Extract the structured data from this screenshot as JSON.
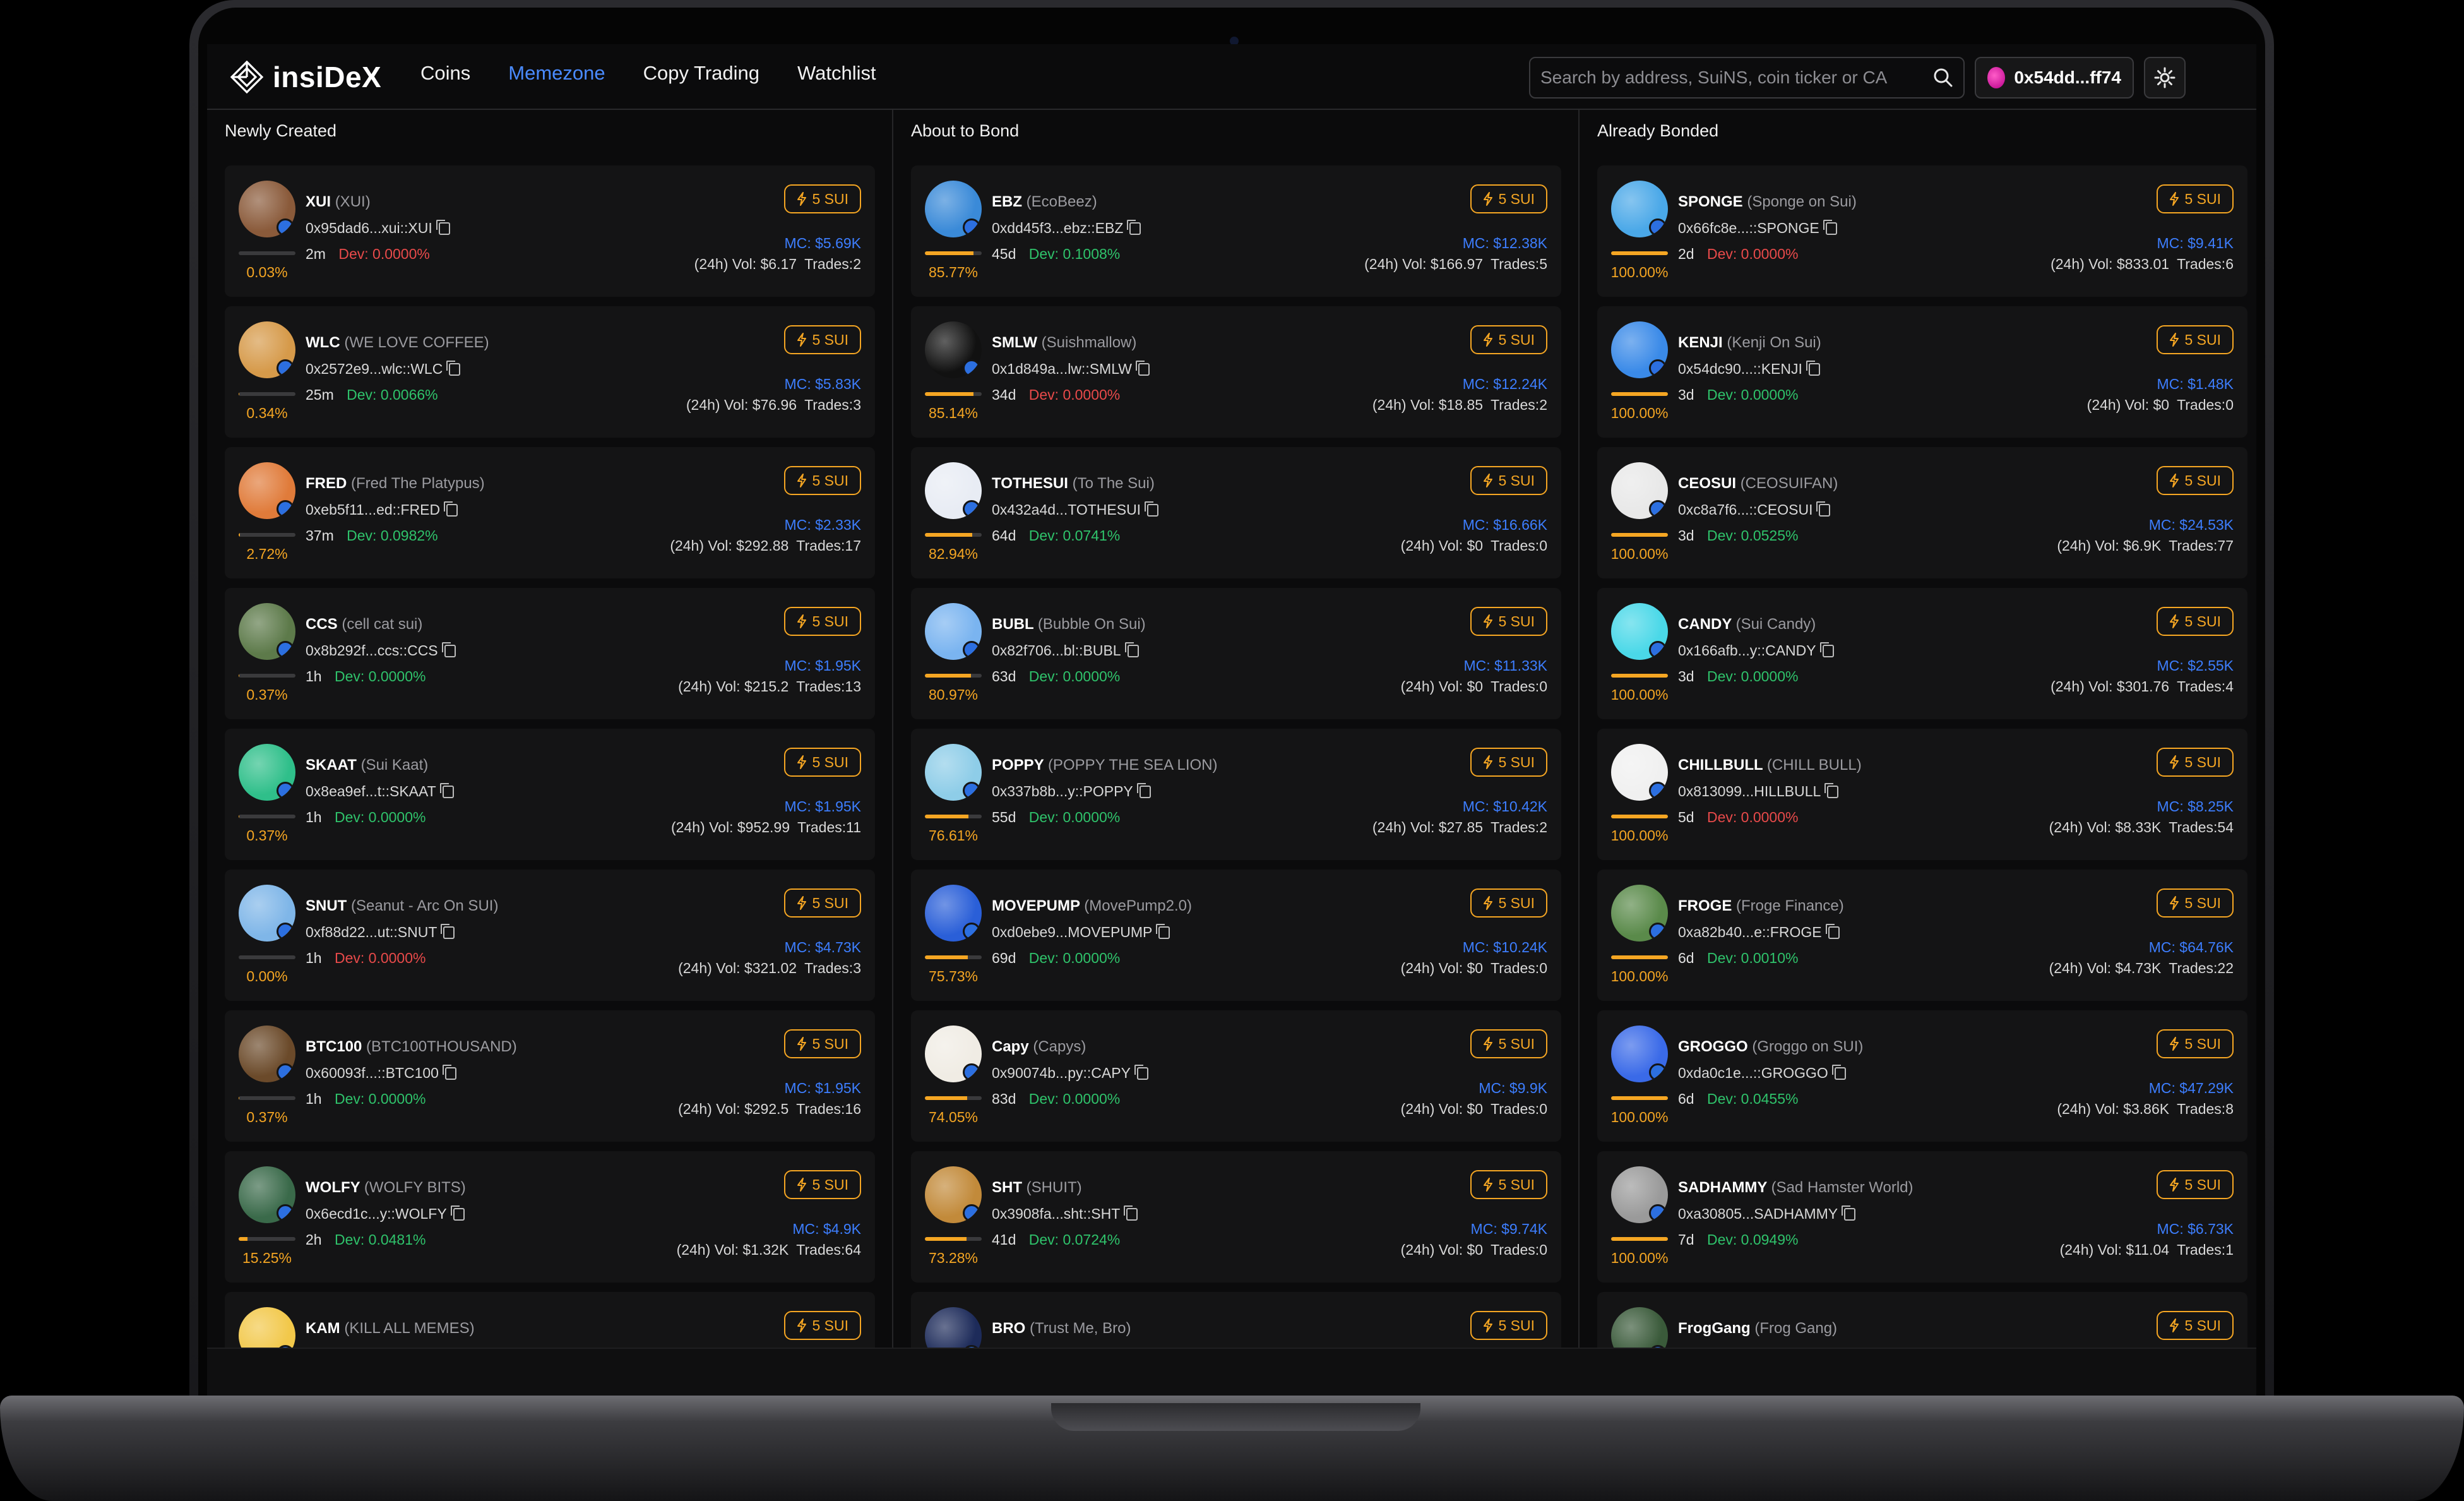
{
  "app": {
    "name": "insiDeX"
  },
  "nav": {
    "items": [
      "Coins",
      "Memezone",
      "Copy Trading",
      "Watchlist"
    ],
    "active": "Memezone"
  },
  "search": {
    "placeholder": "Search by address, SuiNS, coin ticker or CA"
  },
  "wallet": {
    "address": "0x54dd...ff74"
  },
  "colors": {
    "accent": "#4a8bff",
    "buy": "#f5a623",
    "mc": "#3d7eff",
    "dev_negative": "#e84a4a",
    "dev_positive": "#2fc36b"
  },
  "buy_label": "5 SUI",
  "columns": [
    {
      "title": "Newly Created",
      "cards": [
        {
          "ticker": "XUI",
          "name": "(XUI)",
          "address": "0x95dad6...xui::XUI",
          "age": "2m",
          "dev": "Dev: 0.0000%",
          "dev_color": "red",
          "progress": "0.03%",
          "progress_value": 0.03,
          "mc": "MC: $5.69K",
          "vol": "(24h) Vol: $6.17",
          "trades": "Trades:2",
          "avatar": "#8a5a3a",
          "icon": "horse-avatar-icon"
        },
        {
          "ticker": "WLC",
          "name": "(WE LOVE COFFEE)",
          "address": "0x2572e9...wlc::WLC",
          "age": "25m",
          "dev": "Dev: 0.0066%",
          "dev_color": "green",
          "progress": "0.34%",
          "progress_value": 0.34,
          "mc": "MC: $5.83K",
          "vol": "(24h) Vol: $76.96",
          "trades": "Trades:3",
          "avatar": "#d69a4a",
          "icon": "coffee-heart-avatar-icon"
        },
        {
          "ticker": "FRED",
          "name": "(Fred The Platypus)",
          "address": "0xeb5f11...ed::FRED",
          "age": "37m",
          "dev": "Dev: 0.0982%",
          "dev_color": "green",
          "progress": "2.72%",
          "progress_value": 2.72,
          "mc": "MC: $2.33K",
          "vol": "(24h) Vol: $292.88",
          "trades": "Trades:17",
          "avatar": "#e07b3a",
          "icon": "platypus-avatar-icon"
        },
        {
          "ticker": "CCS",
          "name": "(cell cat sui)",
          "address": "0x8b292f...ccs::CCS",
          "age": "1h",
          "dev": "Dev: 0.0000%",
          "dev_color": "green",
          "progress": "0.37%",
          "progress_value": 0.37,
          "mc": "MC: $1.95K",
          "vol": "(24h) Vol: $215.2",
          "trades": "Trades:13",
          "avatar": "#5d7a4a",
          "icon": "cat-avatar-icon"
        },
        {
          "ticker": "SKAAT",
          "name": "(Sui Kaat)",
          "address": "0x8ea9ef...t::SKAAT",
          "age": "1h",
          "dev": "Dev: 0.0000%",
          "dev_color": "green",
          "progress": "0.37%",
          "progress_value": 0.37,
          "mc": "MC: $1.95K",
          "vol": "(24h) Vol: $952.99",
          "trades": "Trades:11",
          "avatar": "#2fbf8a",
          "icon": "tiger-avatar-icon"
        },
        {
          "ticker": "SNUT",
          "name": "(Seanut - Arc On SUI)",
          "address": "0xf88d22...ut::SNUT",
          "age": "1h",
          "dev": "Dev: 0.0000%",
          "dev_color": "red",
          "progress": "0.00%",
          "progress_value": 0,
          "mc": "MC: $4.73K",
          "vol": "(24h) Vol: $321.02",
          "trades": "Trades:3",
          "avatar": "#7fb6e8",
          "icon": "squirrel-avatar-icon"
        },
        {
          "ticker": "BTC100",
          "name": "(BTC100THOUSAND)",
          "address": "0x60093f...::BTC100",
          "age": "1h",
          "dev": "Dev: 0.0000%",
          "dev_color": "green",
          "progress": "0.37%",
          "progress_value": 0.37,
          "mc": "MC: $1.95K",
          "vol": "(24h) Vol: $292.5",
          "trades": "Trades:16",
          "avatar": "#6b4a2a",
          "icon": "monkey-avatar-icon"
        },
        {
          "ticker": "WOLFY",
          "name": "(WOLFY BITS)",
          "address": "0x6ecd1c...y::WOLFY",
          "age": "2h",
          "dev": "Dev: 0.0481%",
          "dev_color": "green",
          "progress": "15.25%",
          "progress_value": 15.25,
          "mc": "MC: $4.9K",
          "vol": "(24h) Vol: $1.32K",
          "trades": "Trades:64",
          "avatar": "#3a6a4a",
          "icon": "wolf-avatar-icon"
        },
        {
          "ticker": "KAM",
          "name": "(KILL ALL MEMES)",
          "address": "",
          "age": "",
          "dev": "",
          "dev_color": "green",
          "progress": "",
          "progress_value": 0,
          "mc": "",
          "vol": "",
          "trades": "",
          "avatar": "#f2c84a",
          "icon": "face-avatar-icon"
        }
      ]
    },
    {
      "title": "About to Bond",
      "cards": [
        {
          "ticker": "EBZ",
          "name": "(EcoBeez)",
          "address": "0xdd45f3...ebz::EBZ",
          "age": "45d",
          "dev": "Dev: 0.1008%",
          "dev_color": "green",
          "progress": "85.77%",
          "progress_value": 85.77,
          "mc": "MC: $12.38K",
          "vol": "(24h) Vol: $166.97",
          "trades": "Trades:5",
          "avatar": "#3a8ad8",
          "icon": "bee-avatar-icon"
        },
        {
          "ticker": "SMLW",
          "name": "(Suishmallow)",
          "address": "0x1d849a...lw::SMLW",
          "age": "34d",
          "dev": "Dev: 0.0000%",
          "dev_color": "red",
          "progress": "85.14%",
          "progress_value": 85.14,
          "mc": "MC: $12.24K",
          "vol": "(24h) Vol: $18.85",
          "trades": "Trades:2",
          "avatar": "#111111",
          "icon": "marshmallow-avatar-icon"
        },
        {
          "ticker": "TOTHESUI",
          "name": "(To The Sui)",
          "address": "0x432a4d...TOTHESUI",
          "age": "64d",
          "dev": "Dev: 0.0741%",
          "dev_color": "green",
          "progress": "82.94%",
          "progress_value": 82.94,
          "mc": "MC: $16.66K",
          "vol": "(24h) Vol: $0",
          "trades": "Trades:0",
          "avatar": "#e8ecf4",
          "icon": "rocket-avatar-icon"
        },
        {
          "ticker": "BUBL",
          "name": "(Bubble On Sui)",
          "address": "0x82f706...bl::BUBL",
          "age": "63d",
          "dev": "Dev: 0.0000%",
          "dev_color": "green",
          "progress": "80.97%",
          "progress_value": 80.97,
          "mc": "MC: $11.33K",
          "vol": "(24h) Vol: $0",
          "trades": "Trades:0",
          "avatar": "#7ab4f0",
          "icon": "pig-avatar-icon"
        },
        {
          "ticker": "POPPY",
          "name": "(POPPY THE SEA LION)",
          "address": "0x337b8b...y::POPPY",
          "age": "55d",
          "dev": "Dev: 0.0000%",
          "dev_color": "green",
          "progress": "76.61%",
          "progress_value": 76.61,
          "mc": "MC: $10.42K",
          "vol": "(24h) Vol: $27.85",
          "trades": "Trades:2",
          "avatar": "#8ecde8",
          "icon": "sea-lion-avatar-icon"
        },
        {
          "ticker": "MOVEPUMP",
          "name": "(MovePump2.0)",
          "address": "0xd0ebe9...MOVEPUMP",
          "age": "69d",
          "dev": "Dev: 0.0000%",
          "dev_color": "green",
          "progress": "75.73%",
          "progress_value": 75.73,
          "mc": "MC: $10.24K",
          "vol": "(24h) Vol: $0",
          "trades": "Trades:0",
          "avatar": "#2a5fd8",
          "icon": "wave-avatar-icon"
        },
        {
          "ticker": "Capy",
          "name": "(Capys)",
          "address": "0x90074b...py::CAPY",
          "age": "83d",
          "dev": "Dev: 0.0000%",
          "dev_color": "green",
          "progress": "74.05%",
          "progress_value": 74.05,
          "mc": "MC: $9.9K",
          "vol": "(24h) Vol: $0",
          "trades": "Trades:0",
          "avatar": "#f0ece4",
          "icon": "capybara-avatar-icon"
        },
        {
          "ticker": "SHT",
          "name": "(SHUIT)",
          "address": "0x3908fa...sht::SHT",
          "age": "41d",
          "dev": "Dev: 0.0724%",
          "dev_color": "green",
          "progress": "73.28%",
          "progress_value": 73.28,
          "mc": "MC: $9.74K",
          "vol": "(24h) Vol: $0",
          "trades": "Trades:0",
          "avatar": "#c28a3a",
          "icon": "blob-avatar-icon"
        },
        {
          "ticker": "BRO",
          "name": "(Trust Me, Bro)",
          "address": "",
          "age": "",
          "dev": "",
          "dev_color": "green",
          "progress": "",
          "progress_value": 0,
          "mc": "",
          "vol": "",
          "trades": "",
          "avatar": "#1d2b5a",
          "icon": "bro-avatar-icon"
        }
      ]
    },
    {
      "title": "Already Bonded",
      "cards": [
        {
          "ticker": "SPONGE",
          "name": "(Sponge on Sui)",
          "address": "0x66fc8e...::SPONGE",
          "age": "2d",
          "dev": "Dev: 0.0000%",
          "dev_color": "red",
          "progress": "100.00%",
          "progress_value": 100,
          "mc": "MC: $9.41K",
          "vol": "(24h) Vol: $833.01",
          "trades": "Trades:6",
          "avatar": "#4aa8e8",
          "icon": "sponge-avatar-icon"
        },
        {
          "ticker": "KENJI",
          "name": "(Kenji On Sui)",
          "address": "0x54dc90...::KENJI",
          "age": "3d",
          "dev": "Dev: 0.0000%",
          "dev_color": "green",
          "progress": "100.00%",
          "progress_value": 100,
          "mc": "MC: $1.48K",
          "vol": "(24h) Vol: $0",
          "trades": "Trades:0",
          "avatar": "#3a8ae8",
          "icon": "dog-avatar-icon"
        },
        {
          "ticker": "CEOSUI",
          "name": "(CEOSUIFAN)",
          "address": "0xc8a7f6...::CEOSUI",
          "age": "3d",
          "dev": "Dev: 0.0525%",
          "dev_color": "green",
          "progress": "100.00%",
          "progress_value": 100,
          "mc": "MC: $24.53K",
          "vol": "(24h) Vol: $6.9K",
          "trades": "Trades:77",
          "avatar": "#e8e8e8",
          "icon": "ceo-avatar-icon"
        },
        {
          "ticker": "CANDY",
          "name": "(Sui Candy)",
          "address": "0x166afb...y::CANDY",
          "age": "3d",
          "dev": "Dev: 0.0000%",
          "dev_color": "green",
          "progress": "100.00%",
          "progress_value": 100,
          "mc": "MC: $2.55K",
          "vol": "(24h) Vol: $301.76",
          "trades": "Trades:4",
          "avatar": "#4ad8e8",
          "icon": "candy-avatar-icon"
        },
        {
          "ticker": "CHILLBULL",
          "name": "(CHILL BULL)",
          "address": "0x813099...HILLBULL",
          "age": "5d",
          "dev": "Dev: 0.0000%",
          "dev_color": "red",
          "progress": "100.00%",
          "progress_value": 100,
          "mc": "MC: $8.25K",
          "vol": "(24h) Vol: $8.33K",
          "trades": "Trades:54",
          "avatar": "#f0f0f0",
          "icon": "bull-avatar-icon"
        },
        {
          "ticker": "FROGE",
          "name": "(Froge Finance)",
          "address": "0xa82b40...e::FROGE",
          "age": "6d",
          "dev": "Dev: 0.0010%",
          "dev_color": "green",
          "progress": "100.00%",
          "progress_value": 100,
          "mc": "MC: $64.76K",
          "vol": "(24h) Vol: $4.73K",
          "trades": "Trades:22",
          "avatar": "#5a8a4a",
          "icon": "frog-avatar-icon"
        },
        {
          "ticker": "GROGGO",
          "name": "(Groggo on SUI)",
          "address": "0xda0c1e...::GROGGO",
          "age": "6d",
          "dev": "Dev: 0.0455%",
          "dev_color": "green",
          "progress": "100.00%",
          "progress_value": 100,
          "mc": "MC: $47.29K",
          "vol": "(24h) Vol: $3.86K",
          "trades": "Trades:8",
          "avatar": "#3a6ae8",
          "icon": "groggo-avatar-icon"
        },
        {
          "ticker": "SADHAMMY",
          "name": "(Sad Hamster World)",
          "address": "0xa30805...SADHAMMY",
          "age": "7d",
          "dev": "Dev: 0.0949%",
          "dev_color": "green",
          "progress": "100.00%",
          "progress_value": 100,
          "mc": "MC: $6.73K",
          "vol": "(24h) Vol: $11.04",
          "trades": "Trades:1",
          "avatar": "#9a9a9a",
          "icon": "hamster-avatar-icon"
        },
        {
          "ticker": "FrogGang",
          "name": "(Frog Gang)",
          "address": "",
          "age": "",
          "dev": "",
          "dev_color": "green",
          "progress": "",
          "progress_value": 0,
          "mc": "",
          "vol": "",
          "trades": "",
          "avatar": "#3a5a3a",
          "icon": "frog-gang-avatar-icon"
        }
      ]
    }
  ]
}
